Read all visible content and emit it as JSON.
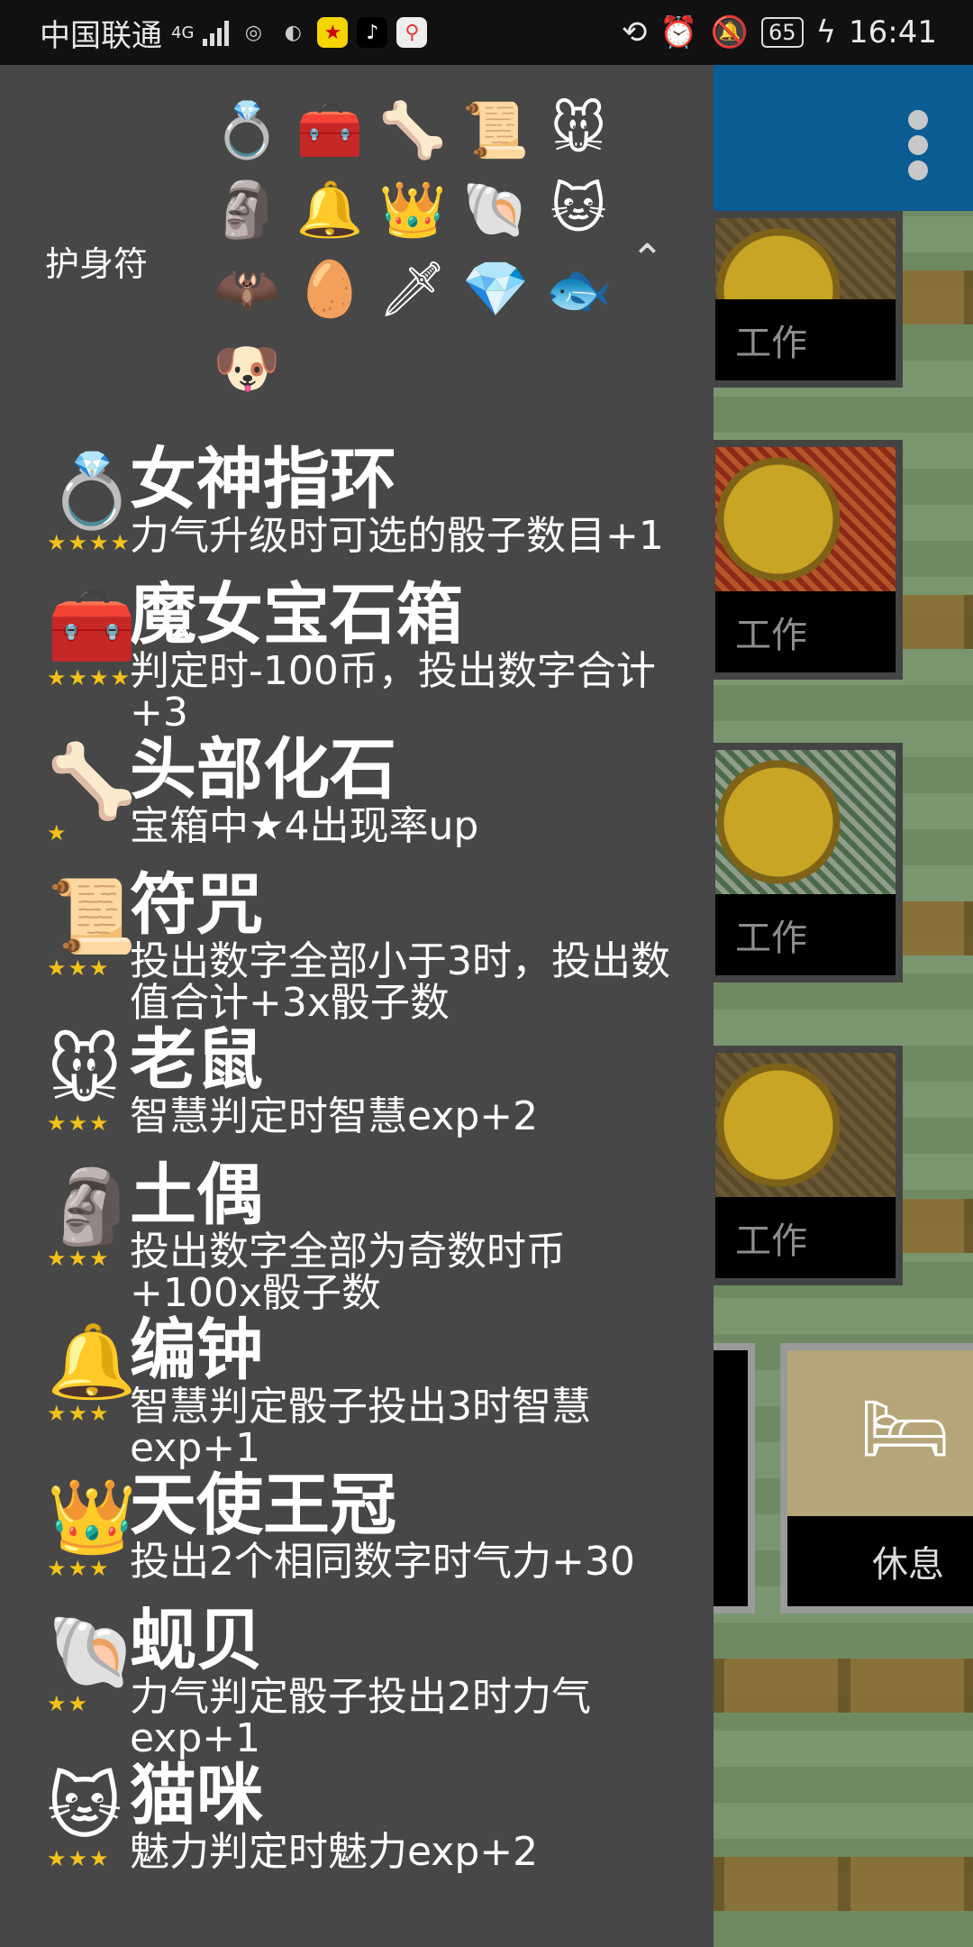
{
  "status_bar": {
    "carrier": "中国联通",
    "network": "4G",
    "battery": "65",
    "time": "16:41"
  },
  "drawer": {
    "section_title": "护身符",
    "charm_icons": [
      "ring-icon",
      "gem-chest-icon",
      "skull-fossil-icon",
      "talisman-icon",
      "mouse-icon",
      "clay-figure-icon",
      "bell-icon",
      "crown-icon",
      "shell-icon",
      "cat-icon",
      "bat-icon",
      "egg-icon",
      "sword-icon",
      "tiara-icon",
      "fish-icon",
      "dog-icon"
    ],
    "items": [
      {
        "name": "女神指环",
        "stars": "★★★★",
        "icon": "💍",
        "desc": "力气升级时可选的骰子数目+1"
      },
      {
        "name": "魔女宝石箱",
        "stars": "★★★★",
        "icon": "🧰",
        "desc": "判定时-100币，投出数字合计+3"
      },
      {
        "name": "头部化石",
        "stars": "★",
        "icon": "🦴",
        "desc": "宝箱中★4出现率up"
      },
      {
        "name": "符咒",
        "stars": "★★★",
        "icon": "📜",
        "desc": "投出数字全部小于3时，投出数值合计+3x骰子数"
      },
      {
        "name": "老鼠",
        "stars": "★★★",
        "icon": "🐭",
        "desc": "智慧判定时智慧exp+2"
      },
      {
        "name": "土偶",
        "stars": "★★★",
        "icon": "🗿",
        "desc": "投出数字全部为奇数时币+100x骰子数"
      },
      {
        "name": "编钟",
        "stars": "★★★",
        "icon": "🔔",
        "desc": "智慧判定骰子投出3时智慧exp+1"
      },
      {
        "name": "天使王冠",
        "stars": "★★★",
        "icon": "👑",
        "desc": "投出2个相同数字时气力+30"
      },
      {
        "name": "蚬贝",
        "stars": "★★",
        "icon": "🐚",
        "desc": "力气判定骰子投出2时力气exp+1"
      },
      {
        "name": "猫咪",
        "stars": "★★★",
        "icon": "🐱",
        "desc": "魅力判定时魅力exp+2"
      }
    ]
  },
  "background": {
    "work_label": "工作",
    "rest_label": "休息"
  }
}
